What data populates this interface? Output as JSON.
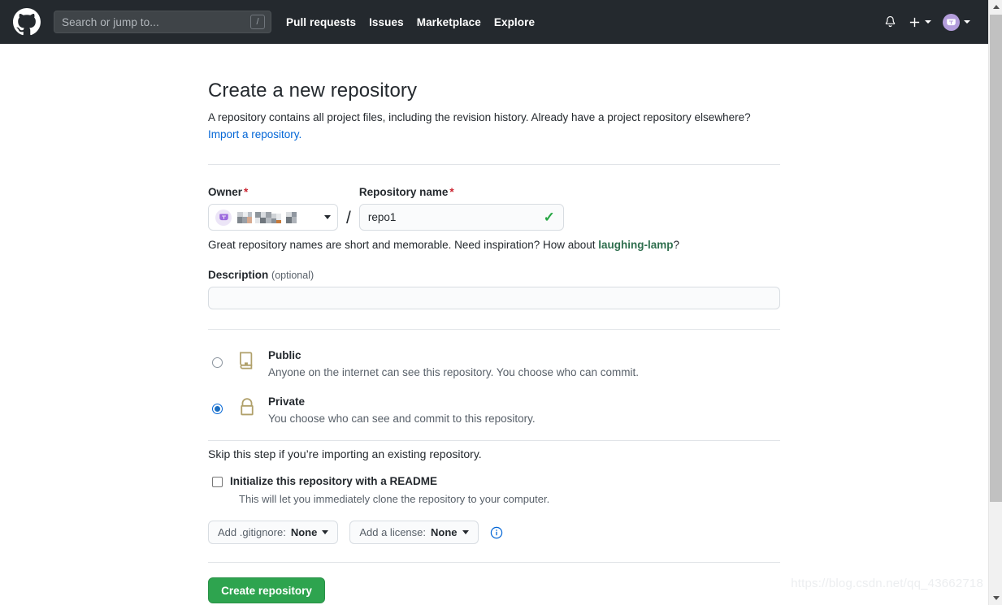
{
  "header": {
    "logo_icon": "github-mark-icon",
    "search": {
      "placeholder": "Search or jump to...",
      "shortcut_key": "/"
    },
    "nav_items": [
      {
        "label": "Pull requests"
      },
      {
        "label": "Issues"
      },
      {
        "label": "Marketplace"
      },
      {
        "label": "Explore"
      }
    ],
    "notifications_icon": "bell-icon",
    "create_new_icon": "plus-icon",
    "account_icon": "avatar-icon",
    "background_color": "#24292e"
  },
  "main": {
    "title": "Create a new repository",
    "subtitle": "A repository contains all project files, including the revision history. Already have a project repository elsewhere?",
    "import_link": "Import a repository.",
    "owner": {
      "label": "Owner",
      "required_mark": "*",
      "value": "",
      "value_is_redacted": true
    },
    "repo_name": {
      "label": "Repository name",
      "required_mark": "*",
      "value": "repo1",
      "valid_icon": "check-icon",
      "valid_color": "#28a745"
    },
    "separator": "/",
    "name_hint_prefix": "Great repository names are short and memorable. Need inspiration? How about ",
    "name_hint_suggestion": "laughing-lamp",
    "name_hint_suffix": "?",
    "description": {
      "label": "Description",
      "optional_text": "(optional)",
      "value": "",
      "placeholder": ""
    },
    "visibility": [
      {
        "id": "public",
        "title": "Public",
        "description": "Anyone on the internet can see this repository. You choose who can commit.",
        "icon": "repo-book-icon",
        "selected": false
      },
      {
        "id": "private",
        "title": "Private",
        "description": "You choose who can see and commit to this repository.",
        "icon": "lock-icon",
        "selected": true
      }
    ],
    "skip_text": "Skip this step if you’re importing an existing repository.",
    "readme": {
      "title": "Initialize this repository with a README",
      "description": "This will let you immediately clone the repository to your computer.",
      "checked": false
    },
    "gitignore_button": {
      "prefix": "Add .gitignore: ",
      "value": "None",
      "caret_icon": "chevron-down-icon"
    },
    "license_button": {
      "prefix": "Add a license: ",
      "value": "None",
      "caret_icon": "chevron-down-icon"
    },
    "info_icon": "info-circle-icon",
    "submit_button": {
      "label": "Create repository",
      "color": "#2ea44f"
    }
  },
  "watermark": "https://blog.csdn.net/qq_43662718",
  "scrollbar": {
    "up_arrow_icon": "triangle-up-icon",
    "down_arrow_icon": "triangle-down-icon"
  }
}
